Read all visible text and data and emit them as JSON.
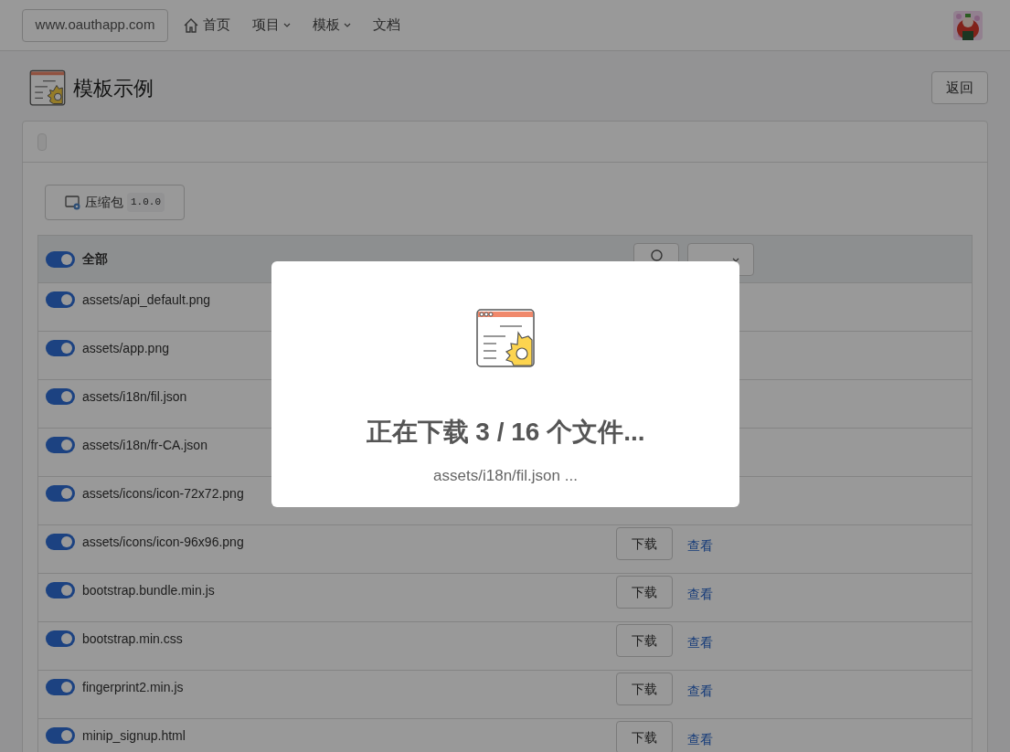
{
  "header": {
    "site": "www.oauthapp.com",
    "nav": [
      {
        "label": "首页",
        "kind": "home"
      },
      {
        "label": "项目",
        "kind": "dropdown"
      },
      {
        "label": "模板",
        "kind": "dropdown"
      },
      {
        "label": "文档",
        "kind": "link"
      }
    ]
  },
  "page": {
    "title": "模板示例",
    "back": "返回"
  },
  "package": {
    "label": "压缩包",
    "version": "1.0.0"
  },
  "table": {
    "header": {
      "label": "全部",
      "on": true
    },
    "rows": [
      {
        "name": "assets/api_default.png",
        "on": true
      },
      {
        "name": "assets/app.png",
        "on": true
      },
      {
        "name": "assets/i18n/fil.json",
        "on": true
      },
      {
        "name": "assets/i18n/fr-CA.json",
        "on": true
      },
      {
        "name": "assets/icons/icon-72x72.png",
        "on": true
      },
      {
        "name": "assets/icons/icon-96x96.png",
        "on": true,
        "download": "下载",
        "view": "查看"
      },
      {
        "name": "bootstrap.bundle.min.js",
        "on": true,
        "download": "下载",
        "view": "查看"
      },
      {
        "name": "bootstrap.min.css",
        "on": true,
        "download": "下载",
        "view": "查看"
      },
      {
        "name": "fingerprint2.min.js",
        "on": true,
        "download": "下载",
        "view": "查看"
      },
      {
        "name": "minip_signup.html",
        "on": true,
        "download": "下载",
        "view": "查看"
      }
    ]
  },
  "modal": {
    "title": "正在下载 3 / 16 个文件...",
    "file": "assets/i18n/fil.json ..."
  }
}
